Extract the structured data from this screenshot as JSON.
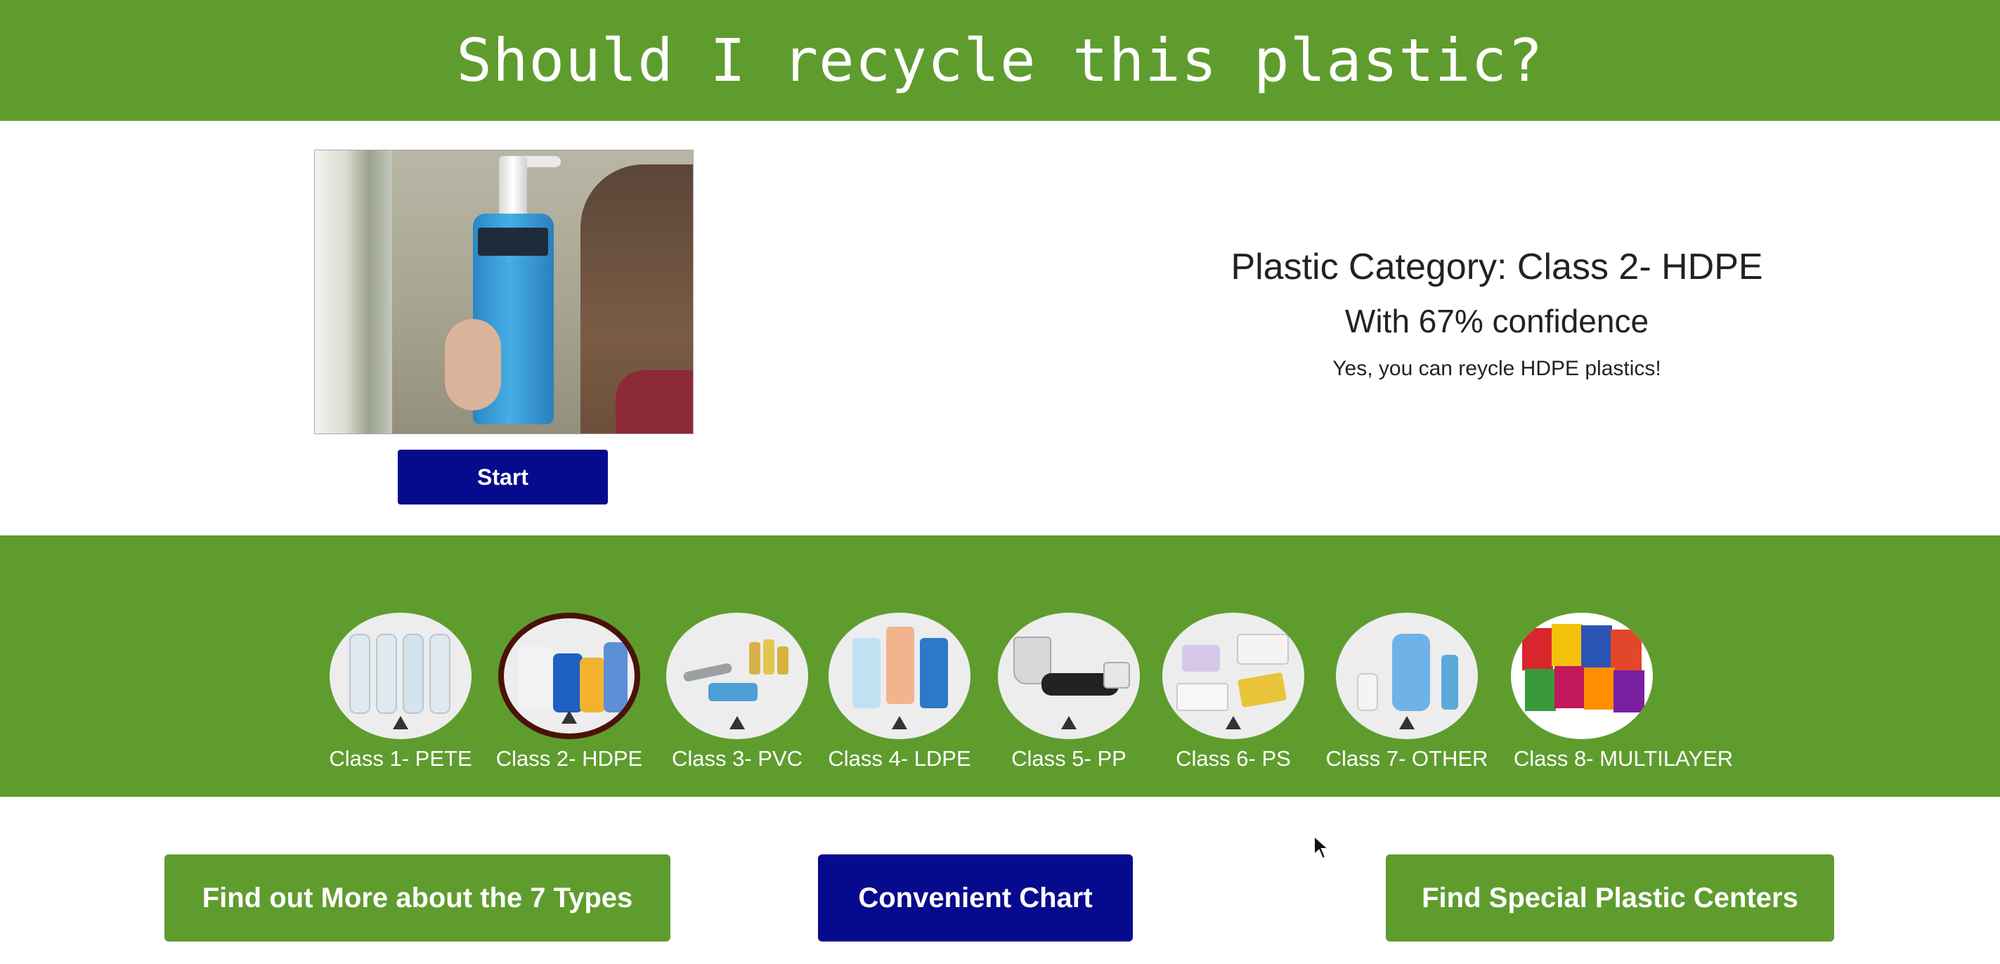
{
  "header": {
    "title": "Should I recycle this plastic?"
  },
  "webcam": {
    "label": "webcam feed"
  },
  "controls": {
    "start_label": "Start"
  },
  "result": {
    "category": "Plastic Category: Class 2- HDPE",
    "confidence": "With 67% confidence",
    "advice": "Yes, you can reycle HDPE plastics!"
  },
  "classes": [
    {
      "label": "Class 1- PETE"
    },
    {
      "label": "Class 2- HDPE"
    },
    {
      "label": "Class 3- PVC"
    },
    {
      "label": "Class 4- LDPE"
    },
    {
      "label": "Class 5- PP"
    },
    {
      "label": "Class 6- PS"
    },
    {
      "label": "Class 7- OTHER"
    },
    {
      "label": "Class 8- MULTILAYER"
    }
  ],
  "buttons": {
    "more_types": "Find out More about the 7 Types",
    "chart": "Convenient Chart",
    "centers": "Find Special Plastic Centers"
  },
  "colors": {
    "green": "#5f9c2e",
    "navy": "#060a8c",
    "selected_border": "#4a1208"
  }
}
